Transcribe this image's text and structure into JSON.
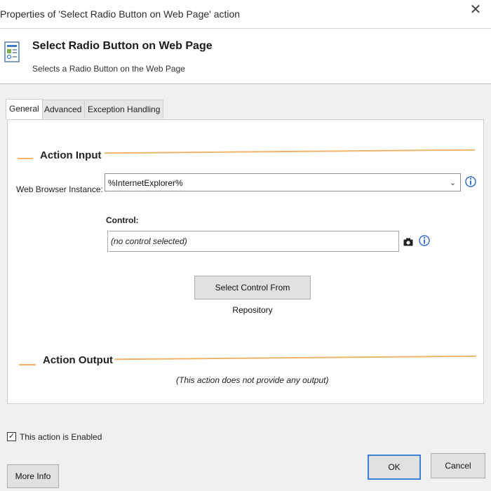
{
  "window": {
    "title": "Properties of 'Select Radio Button on Web Page' action",
    "close_glyph": "✕"
  },
  "header": {
    "title": "Select Radio Button on Web Page",
    "subtitle": "Selects a Radio Button on the Web Page",
    "icon": "web-form-icon"
  },
  "tabs": [
    {
      "label": "General",
      "active": true
    },
    {
      "label": "Advanced",
      "active": false
    },
    {
      "label": "Exception Handling",
      "active": false
    }
  ],
  "action_input": {
    "heading": "Action Input",
    "browser_label": "Web Browser Instance:",
    "browser_value": "%InternetExplorer%",
    "control_label": "Control:",
    "control_value": "(no control selected)",
    "select_button": "Select Control From Repository"
  },
  "action_output": {
    "heading": "Action Output",
    "note": "(This action does not provide any output)"
  },
  "footer": {
    "enabled_label": "This action is Enabled",
    "enabled_checked": true,
    "more_info": "More Info",
    "ok": "OK",
    "cancel": "Cancel"
  },
  "colors": {
    "accent_rule": "#f0b46a",
    "info_icon": "#3a6fd8",
    "primary_border": "#3c7fd6"
  }
}
